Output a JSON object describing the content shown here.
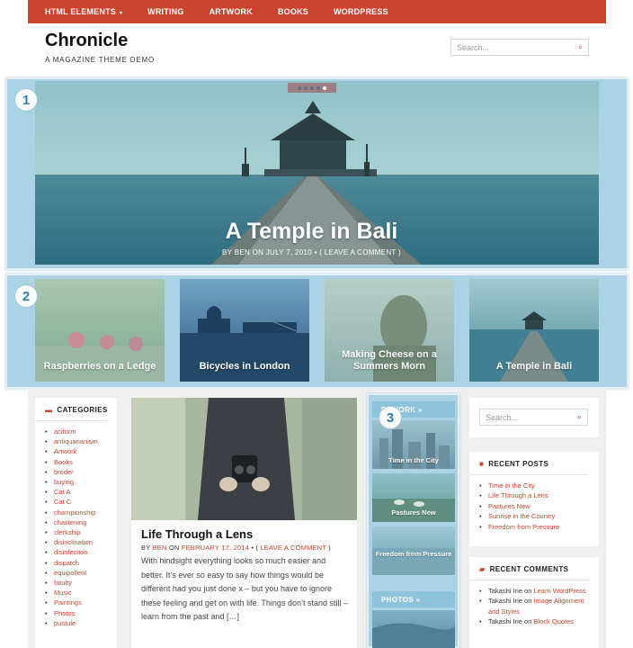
{
  "nav": {
    "items": [
      "HTML ELEMENTS",
      "WRITING",
      "ARTWORK",
      "BOOKS",
      "WORDPRESS"
    ],
    "caret": "▾"
  },
  "site": {
    "title": "Chronicle",
    "tagline": "A MAGAZINE THEME DEMO"
  },
  "search": {
    "placeholder": "Search..."
  },
  "hero": {
    "title": "A Temple in Bali",
    "meta_by": "BY ",
    "meta_author": "BEN",
    "meta_on": " ON ",
    "meta_date": "JULY 7, 2010",
    "meta_sep": " • ( ",
    "meta_comment": "LEAVE A COMMENT",
    "meta_end": " )"
  },
  "featured": [
    {
      "label": "Raspberries on a Ledge"
    },
    {
      "label": "Bicycles in London"
    },
    {
      "label": "Making Cheese on a Summers Morn"
    },
    {
      "label": "A Temple in Bali"
    }
  ],
  "badges": [
    "1",
    "2",
    "3"
  ],
  "categories": {
    "title": "CATEGORIES",
    "items": [
      "aciform",
      "antiquarianism",
      "Artwork",
      "Books",
      "broder",
      "buying",
      "Cat A",
      "Cat C",
      "championship",
      "chastening",
      "clerkship",
      "disinclination",
      "disinfection",
      "dispatch",
      "equipollent",
      "fatuity",
      "Music",
      "Paintings",
      "Photos",
      "pustule"
    ]
  },
  "post": {
    "title": "Life Through a Lens",
    "meta_by": "BY ",
    "meta_author": "BEN",
    "meta_on": " ON ",
    "meta_date": "FEBRUARY 17, 2014",
    "meta_sep": " • ( ",
    "meta_comment": "LEAVE A COMMENT",
    "meta_end": " )",
    "excerpt": "With hindsight everything looks so much easier and better. It’s ever so easy to say how things would be different had you just done x – but you have to ignore these feeling and get on with life. Things don’t stand still – learn from the past and […]"
  },
  "artwork": {
    "header": "RTWORK »",
    "items": [
      "Time in the City",
      "Pastures New",
      "Freedom from Pressure"
    ],
    "photos_header": "PHOTOS »"
  },
  "recent_posts": {
    "title": "RECENT POSTS",
    "items": [
      "Time in the City",
      "Life Through a Lens",
      "Pastures New",
      "Sunrise in the Country",
      "Freedom from Pressure"
    ]
  },
  "recent_comments": {
    "title": "RECENT COMMENTS",
    "items": [
      {
        "author": "Takashi Irie",
        "on": " on ",
        "post": "Learn WordPress"
      },
      {
        "author": "Takashi Irie",
        "on": " on ",
        "post": "Image Alignment and Styles"
      },
      {
        "author": "Takashi Irie",
        "on": " on ",
        "post": "Block Quotes"
      }
    ]
  },
  "colors": {
    "accent": "#c9442d",
    "highlight": "#abd2e5",
    "badge_text": "#2b7fb3"
  }
}
